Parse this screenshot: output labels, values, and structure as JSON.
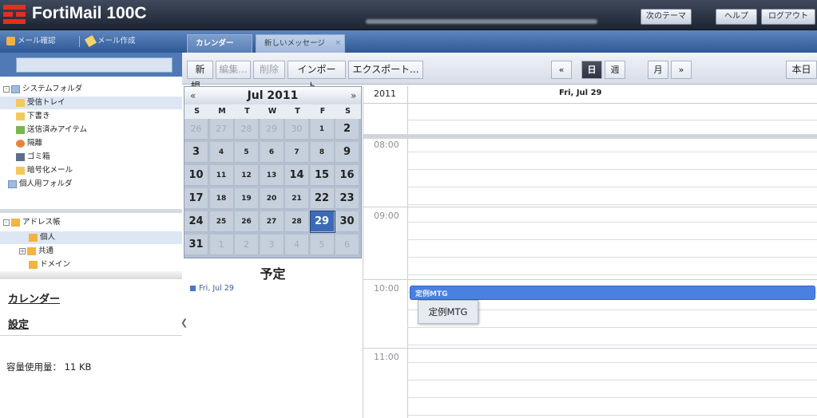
{
  "header": {
    "title": "FortiMail 100C",
    "buttons": {
      "next_theme": "次のテーマ",
      "help": "ヘルプ",
      "logout": "ログアウト"
    }
  },
  "left_toolbar": {
    "check_mail": "メール確認",
    "compose": "メール作成"
  },
  "tree": {
    "system_folder": "システムフォルダ",
    "inbox": "受信トレイ",
    "drafts": "下書き",
    "sent": "送信済みアイテム",
    "quarantine": "隔離",
    "trash": "ゴミ箱",
    "encrypted": "暗号化メール",
    "personal_folder": "個人用フォルダ",
    "address_book": "アドレス帳",
    "personal": "個人",
    "shared": "共通",
    "domain": "ドメイン"
  },
  "links": {
    "calendar": "カレンダー",
    "settings": "設定"
  },
  "usage": {
    "label": "容量使用量：",
    "value": "11 KB"
  },
  "tabs": [
    {
      "label": "カレンダー"
    },
    {
      "label": "新しいメッセージ"
    }
  ],
  "toolbar": {
    "new": "新規...",
    "edit": "編集...",
    "delete": "削除",
    "import": "インポート...",
    "export": "エクスポート...",
    "prev": "«",
    "day": "日",
    "week": "週",
    "month": "月",
    "next": "»",
    "today": "本日"
  },
  "minical": {
    "title": "Jul 2011",
    "prev": "«",
    "next": "»",
    "weekdays": [
      "S",
      "M",
      "T",
      "W",
      "T",
      "F",
      "S"
    ],
    "weeks": [
      [
        "26",
        "27",
        "28",
        "29",
        "30",
        "1",
        "2"
      ],
      [
        "3",
        "4",
        "5",
        "6",
        "7",
        "8",
        "9"
      ],
      [
        "10",
        "11",
        "12",
        "13",
        "14",
        "15",
        "16"
      ],
      [
        "17",
        "18",
        "19",
        "20",
        "21",
        "22",
        "23"
      ],
      [
        "24",
        "25",
        "26",
        "27",
        "28",
        "29",
        "30"
      ],
      [
        "31",
        "1",
        "2",
        "3",
        "4",
        "5",
        "6"
      ]
    ],
    "selected": "29"
  },
  "agenda": {
    "title": "予定",
    "item": "Fri, Jul 29"
  },
  "dayview": {
    "year": "2011",
    "date": "Fri, Jul 29",
    "hours": [
      "08:00",
      "09:00",
      "10:00",
      "11:00"
    ],
    "event_title": "定例MTG",
    "tooltip": "定例MTG"
  },
  "colors": {
    "brand": "#e03020",
    "header": "#2a3344",
    "nav": "#3f6aa8",
    "event": "#4a80e0"
  }
}
